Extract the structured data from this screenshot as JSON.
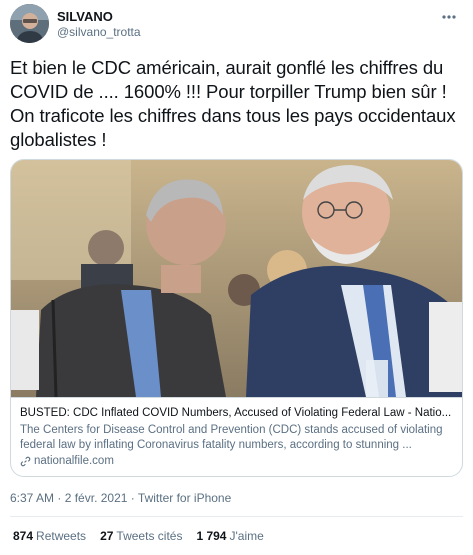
{
  "author": {
    "name": "SILVANO",
    "handle": "@silvano_trotta"
  },
  "tweet": {
    "text": "Et bien le CDC américain, aurait gonflé les chiffres du COVID de .... 1600% !!! Pour torpiller Trump bien sûr !\nOn traficote les chiffres dans tous les pays occidentaux globalistes !"
  },
  "card": {
    "title": "BUSTED: CDC Inflated COVID Numbers, Accused of Violating Federal Law - Natio...",
    "description": "The Centers for Disease Control and Prevention (CDC) stands accused of violating federal law by inflating Coronavirus fatality numbers, according to stunning ...",
    "source": "nationalfile.com"
  },
  "meta": {
    "time": "6:37 AM",
    "separator": "·",
    "date": "2 févr. 2021",
    "client": "Twitter for iPhone"
  },
  "stats": {
    "retweets_count": "874",
    "retweets_label": "Retweets",
    "quotes_count": "27",
    "quotes_label": "Tweets cités",
    "likes_count": "1 794",
    "likes_label": "J'aime"
  },
  "icons": {
    "more": "more-icon",
    "link": "link-icon"
  }
}
